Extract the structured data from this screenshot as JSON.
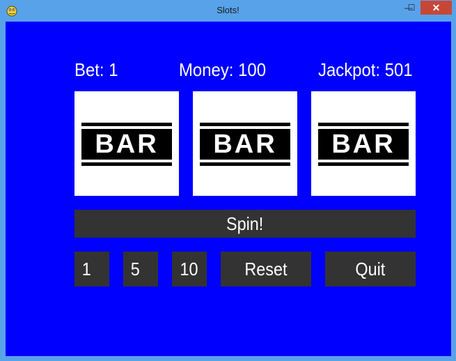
{
  "window": {
    "title": "Slots!",
    "minimize_glyph": "—",
    "maximize_glyph": "☐",
    "close_glyph": "✕"
  },
  "stats": {
    "bet": "Bet: 1",
    "money": "Money: 100",
    "jackpot": "Jackpot: 501"
  },
  "reels": [
    {
      "symbol": "BAR"
    },
    {
      "symbol": "BAR"
    },
    {
      "symbol": "BAR"
    }
  ],
  "controls": {
    "spin_label": "Spin!",
    "bet_1_label": "1",
    "bet_5_label": "5",
    "bet_10_label": "10",
    "reset_label": "Reset",
    "quit_label": "Quit"
  },
  "colors": {
    "background": "#0000FE",
    "button": "#333333",
    "text": "#FFFFFF",
    "reel": "#FFFFFF"
  }
}
